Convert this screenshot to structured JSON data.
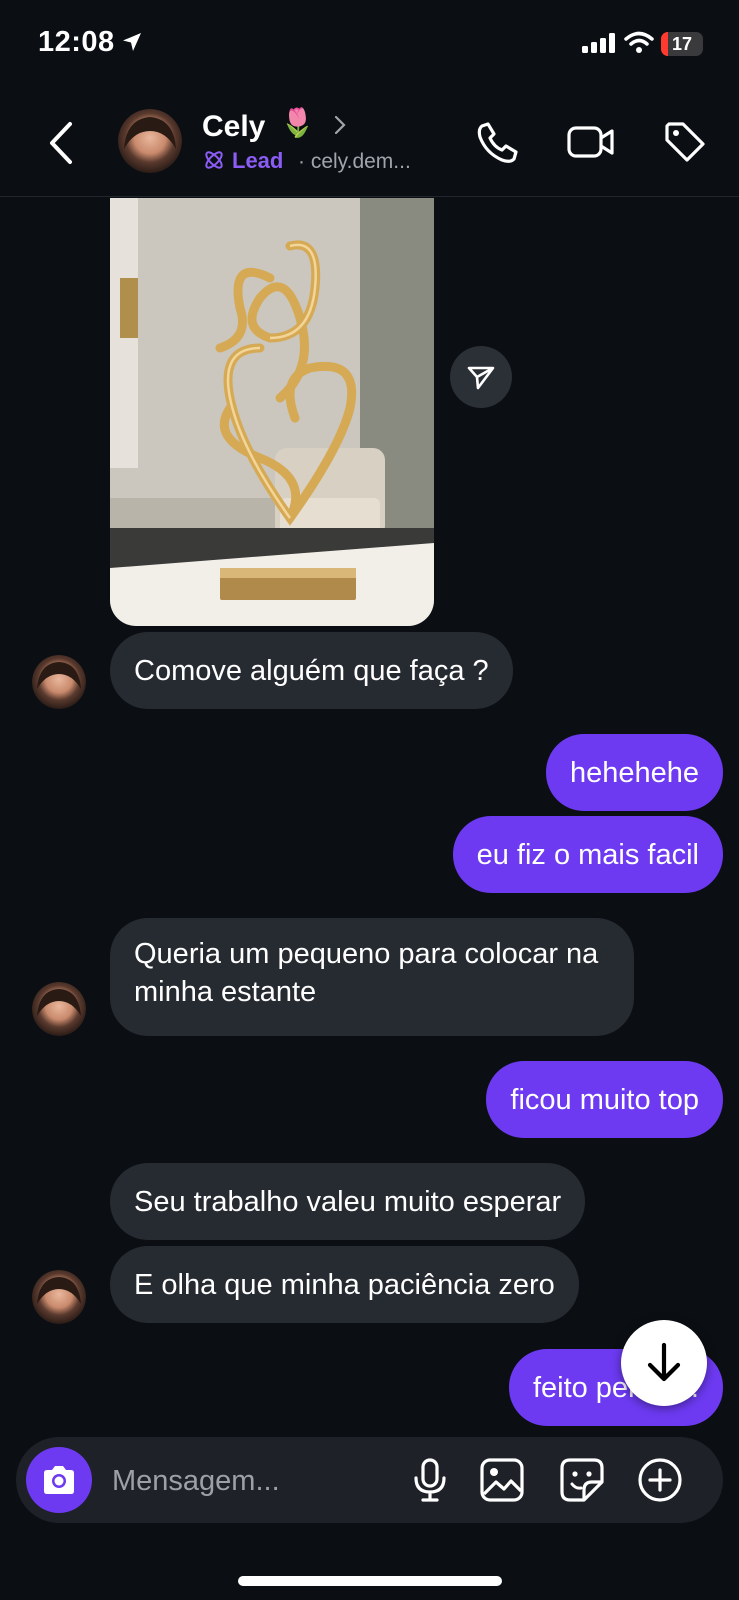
{
  "status_bar": {
    "time": "12:08",
    "battery_level": "17",
    "battery_fraction": 0.17
  },
  "header": {
    "contact_name": "Cely",
    "name_emoji": "🌷",
    "lead_label": "Lead",
    "username": "· cely.dem..."
  },
  "messages": [
    {
      "side": "in",
      "text": "Comove alguém que faça ?"
    },
    {
      "side": "out",
      "text": "hehehehe"
    },
    {
      "side": "out",
      "text": "eu fiz o mais facil"
    },
    {
      "side": "in",
      "text": "Queria um pequeno para colocar na minha estante"
    },
    {
      "side": "out",
      "text": "ficou muito top"
    },
    {
      "side": "in",
      "text": "Seu trabalho valeu muito esperar"
    },
    {
      "side": "in",
      "text": "E olha que minha paciência zero"
    },
    {
      "side": "out",
      "text": "feito pelo d..."
    }
  ],
  "composer": {
    "placeholder": "Mensagem..."
  },
  "colors": {
    "accent": "#6d3af2",
    "lead": "#8b5cf6",
    "background": "#0b0f14",
    "incoming_bubble": "#262a31"
  },
  "icons": [
    "location-arrow-icon",
    "signal-icon",
    "wifi-icon",
    "battery-icon",
    "chevron-left-icon",
    "chevron-right-icon",
    "lead-icon",
    "phone-icon",
    "video-icon",
    "tag-icon",
    "send-icon",
    "arrow-down-icon",
    "camera-icon",
    "microphone-icon",
    "image-icon",
    "sticker-icon",
    "plus-circle-icon"
  ]
}
